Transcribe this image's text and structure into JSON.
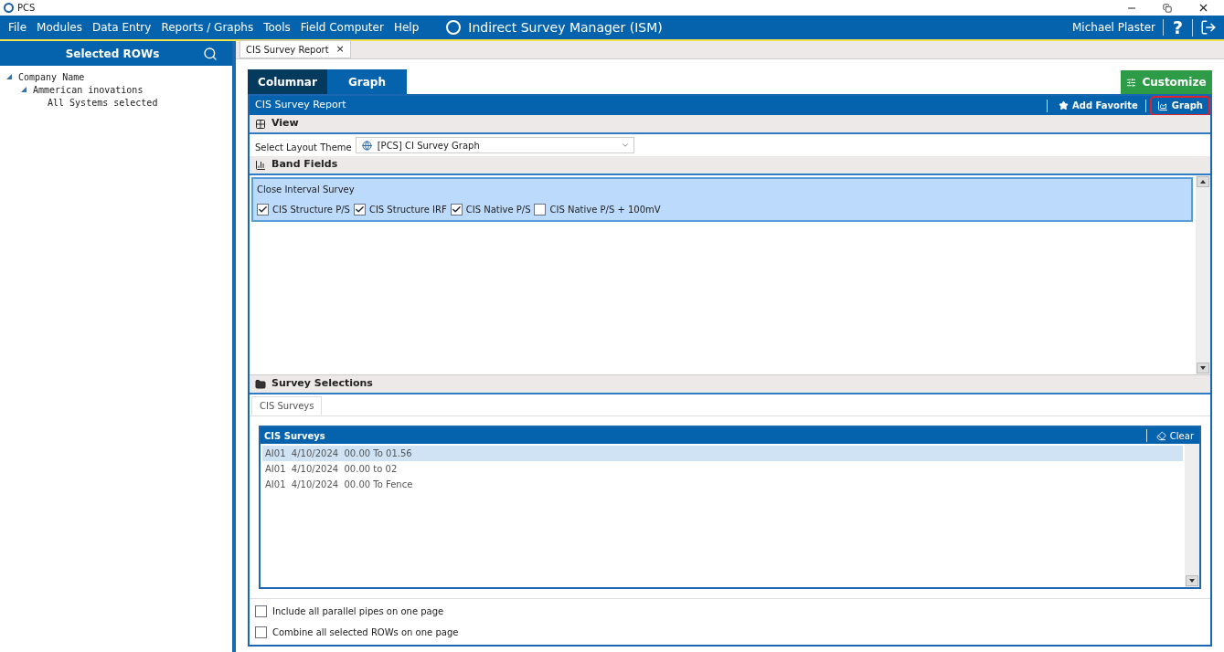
{
  "window": {
    "title": "PCS"
  },
  "menu": [
    "File",
    "Modules",
    "Data Entry",
    "Reports / Graphs",
    "Tools",
    "Field Computer",
    "Help"
  ],
  "app_title": "Indirect Survey Manager (ISM)",
  "user": "Michael Plaster",
  "help_glyph": "?",
  "sidebar": {
    "title": "Selected ROWs",
    "tree": [
      {
        "label": "Company Name",
        "expanded": true,
        "children": [
          {
            "label": "Ammerican inovations",
            "expanded": true,
            "children": [
              {
                "label": "All Systems selected"
              }
            ]
          }
        ]
      }
    ]
  },
  "doc_tabs": [
    {
      "label": "CIS Survey Report",
      "close": "×",
      "selected": true
    }
  ],
  "view_tabs": [
    {
      "label": "Columnar",
      "selected": true
    },
    {
      "label": "Graph",
      "selected": false
    }
  ],
  "customize_button": "Customize",
  "report_bar": {
    "title": "CIS Survey Report",
    "actions": [
      {
        "kind": "star",
        "label": "Add Favorite",
        "highlighted": false
      },
      {
        "kind": "chart",
        "label": "Graph",
        "highlighted": true
      }
    ]
  },
  "view_section": {
    "title": "View",
    "layout_label": "Select Layout Theme",
    "layout_value": "[PCS] CI Survey Graph"
  },
  "band_fields": {
    "title": "Band Fields",
    "groups": [
      {
        "title": "Close Interval Survey",
        "selected": true,
        "fields": [
          {
            "label": "CIS Structure P/S",
            "checked": true
          },
          {
            "label": "CIS Structure IRF",
            "checked": true
          },
          {
            "label": "CIS Native P/S",
            "checked": true
          },
          {
            "label": "CIS Native P/S + 100mV",
            "checked": false
          }
        ]
      }
    ]
  },
  "survey_selections": {
    "title": "Survey Selections",
    "tabs": [
      {
        "label": "CIS Surveys",
        "selected": true
      }
    ],
    "table": {
      "title": "CIS Surveys",
      "clear": "Clear",
      "rows": [
        {
          "text": "AI01  4/10/2024  00.00 To 01.56",
          "selected": true
        },
        {
          "text": "AI01  4/10/2024  00.00 to 02",
          "selected": false
        },
        {
          "text": "AI01  4/10/2024  00.00 To Fence",
          "selected": false
        }
      ]
    }
  },
  "options": [
    {
      "label": "Include all parallel pipes on one page",
      "checked": false
    },
    {
      "label": "Combine all selected ROWs on one page",
      "checked": false
    }
  ]
}
